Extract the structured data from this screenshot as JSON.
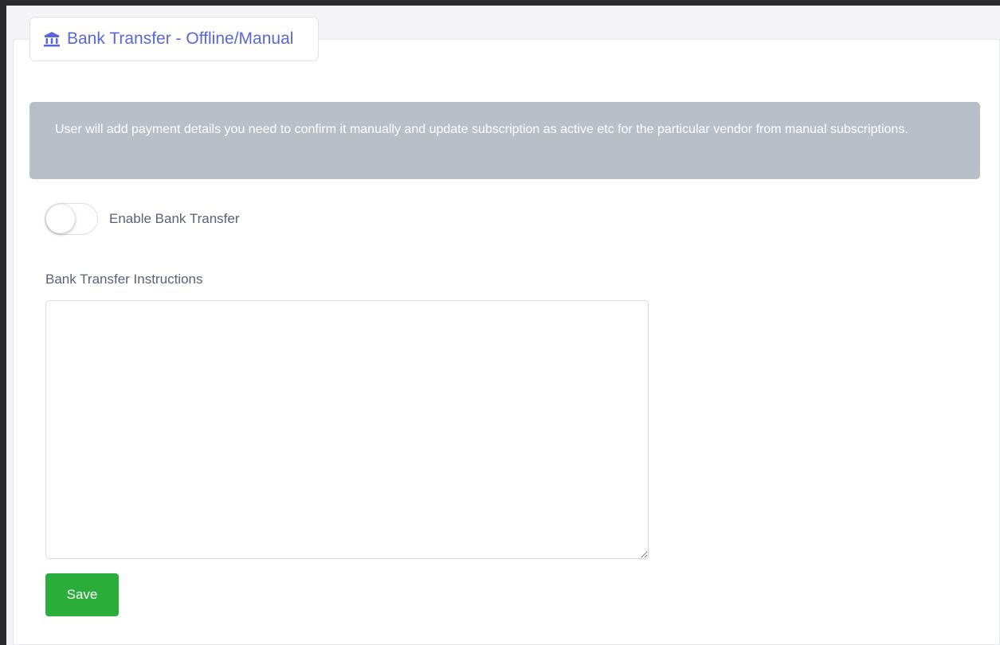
{
  "card": {
    "title": "Bank Transfer - Offline/Manual",
    "title_icon": "bank-icon"
  },
  "notice": {
    "text": "User will add payment details you need to confirm it manually and update subscription as active etc for the particular vendor from manual subscriptions."
  },
  "toggle": {
    "label": "Enable Bank Transfer",
    "enabled": false
  },
  "instructions": {
    "label": "Bank Transfer Instructions",
    "value": ""
  },
  "actions": {
    "save_label": "Save"
  },
  "colors": {
    "accent": "#5867dd",
    "notice_bg": "#b8bfc7",
    "save_bg": "#2aad3a"
  }
}
